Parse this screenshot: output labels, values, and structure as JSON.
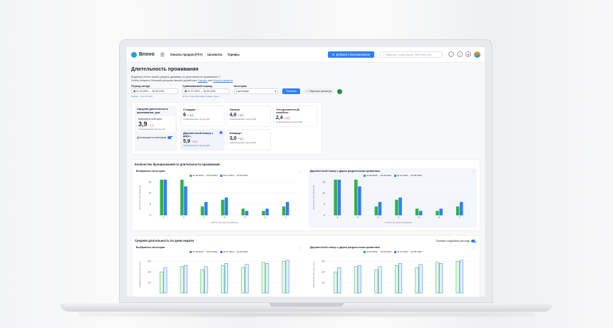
{
  "app": {
    "logo": "Bnovo",
    "nav": [
      "Каналы продаж (ПТА)",
      "Шахматка",
      "Тарифы"
    ],
    "add_button": "Добавить бронирование",
    "search_placeholder": "Фамилия, номер брони, ФИО или ОТА"
  },
  "page": {
    "title": "Длительность проживания",
    "hint1": "В данном отчете можно увидеть динамику по длительности проживания",
    "hint2_prefix": "Чтобы получить больший доход вы можете доработать",
    "hint2_link1": "Тарифы",
    "hint2_mid": "или",
    "hint2_link2": "Бонусы правила"
  },
  "filters": {
    "period_label": "Период заезда",
    "period_value": "01.09.2024 — 30.09.2024",
    "period_sub": "Заезды · Last 12 days",
    "compare_label": "Сравниваемый период",
    "compare_value": "01.07.2024 — 30.09.2024",
    "compare_sub": "Итоги с периода назад: нажать здесь",
    "category_label": "Категория",
    "category_value": "3 категории",
    "show_button": "Показать",
    "reset_button": "Сбросить фильтры"
  },
  "summary": {
    "heading": "Средняя длительность проживания, дни",
    "selected_label": "Выбранные категории",
    "selected_value": "3,9",
    "selected_delta": "+ 0,3",
    "selected_compare_label": "Сравниваемый период",
    "selected_compare_value": "4,2",
    "toggle_label": "Детализация по категориям",
    "compare_label": "Сравниваемый период",
    "categories": [
      {
        "name": "Стандарт",
        "value": "6",
        "delta": "+ 0,6",
        "up": true,
        "compare": "5,3"
      },
      {
        "name": "Эконом",
        "value": "4,6",
        "delta": "+ 0,7",
        "up": false,
        "compare": "6,0"
      },
      {
        "name": "Четырехместный семейны...",
        "value": "2,4",
        "delta": "+ 0,7",
        "up": false,
        "compare": "3,0"
      },
      {
        "name": "Двухместный номер с двух...",
        "value": "5,9",
        "delta": "+ 0,7",
        "up": false,
        "compare": "6,3"
      },
      {
        "name": "Комфорт",
        "value": "3,0",
        "delta": "+ 0,7",
        "up": false,
        "compare": "6,0"
      }
    ]
  },
  "panel1": {
    "title": "Количество бронирований по длительности проживания",
    "legend": [
      "01.09.2024 — 30.09.2024",
      "01.07.2024 — 30.09.2024"
    ],
    "left_title": "Выбранные категории",
    "right_title": "Двухместный номер с двумя раздельными кроватями",
    "xlabel": "Количество дней проживания",
    "ylabel": "Количество бронирований"
  },
  "panel2": {
    "title": "Средняя длительность по дням недели",
    "toggle_label": "Показать подробные расходы",
    "left_title": "Выбранные категории",
    "right_title": "Двухместный номер с двумя раздельными кроватями",
    "ylabel": "Средняя длительность, дни"
  },
  "colors": {
    "green": "#2bb34b",
    "blue": "#2f7ef6",
    "accent": "#2f7ef6"
  },
  "chart_data": [
    {
      "type": "bar",
      "title": "Выбранные категории",
      "categories": [
        "1",
        "2",
        "3",
        "4",
        "5",
        "6",
        "7"
      ],
      "series": [
        {
          "name": "01.09.2024 — 30.09.2024",
          "values": [
            16,
            16,
            4,
            7,
            3,
            2,
            4
          ]
        },
        {
          "name": "01.07.2024 — 30.09.2024",
          "values": [
            16,
            13,
            6,
            8,
            2,
            3,
            6
          ]
        }
      ],
      "ylim": [
        0,
        16
      ],
      "yticks": [
        "0",
        "5",
        "10",
        "15"
      ]
    },
    {
      "type": "bar",
      "title": "Двухместный номер с двумя раздельными кроватями",
      "categories": [
        "1",
        "2",
        "3",
        "4",
        "5",
        "6",
        "7"
      ],
      "series": [
        {
          "name": "01.09.2024 — 30.09.2024",
          "values": [
            16,
            16,
            4,
            7,
            3,
            2,
            4
          ]
        },
        {
          "name": "01.07.2024 — 30.09.2024",
          "values": [
            16,
            13,
            6,
            8,
            2,
            3,
            6
          ]
        }
      ],
      "ylim": [
        0,
        16
      ],
      "yticks": [
        "0",
        "5",
        "10",
        "15"
      ]
    },
    {
      "type": "bar",
      "title": "Выбранные категории",
      "categories": [
        "1",
        "2",
        "3",
        "4",
        "5",
        "6",
        "7"
      ],
      "series": [
        {
          "name": "01.09.2024 — 30.09.2024",
          "values": [
            2.0,
            2.5,
            2.2,
            2.6,
            2.4,
            2.9,
            3.0
          ]
        },
        {
          "name": "01.07.2024 — 30.09.2024",
          "values": [
            2.4,
            2.6,
            2.5,
            2.8,
            2.7,
            2.8,
            3.1
          ]
        }
      ],
      "ylim": [
        0,
        3.5
      ],
      "yticks": [
        "1,0",
        "2,0",
        "3,0"
      ]
    },
    {
      "type": "bar",
      "title": "Двухместный номер с двумя раздельными кроватями",
      "categories": [
        "1",
        "2",
        "3",
        "4",
        "5",
        "6",
        "7"
      ],
      "series": [
        {
          "name": "01.09.2024 — 30.09.2024",
          "values": [
            2.0,
            2.5,
            2.2,
            2.6,
            2.4,
            2.9,
            3.0
          ]
        },
        {
          "name": "01.07.2024 — 30.09.2024",
          "values": [
            2.4,
            2.6,
            2.5,
            2.8,
            2.7,
            2.8,
            3.1
          ]
        }
      ],
      "ylim": [
        0,
        3.5
      ],
      "yticks": [
        "1,0",
        "2,0",
        "3,0"
      ]
    }
  ]
}
